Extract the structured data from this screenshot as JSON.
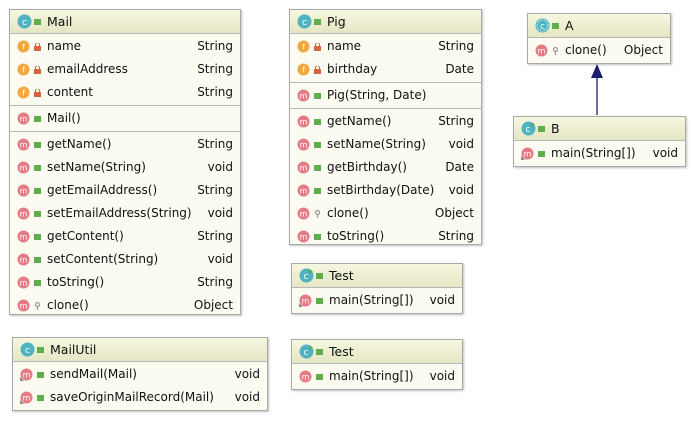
{
  "icon_colors": {
    "class": "#4fb3c2",
    "field": "#f3a83f",
    "method": "#e57b84",
    "lock": "#d3653f",
    "public": "#5fae4b",
    "arrow": "#1a1f6e"
  },
  "classes": {
    "mail": {
      "name": "Mail",
      "fields": [
        {
          "label": "name",
          "type": "String"
        },
        {
          "label": "emailAddress",
          "type": "String"
        },
        {
          "label": "content",
          "type": "String"
        }
      ],
      "constructors": [
        {
          "label": "Mail()",
          "type": ""
        }
      ],
      "methods": [
        {
          "label": "getName()",
          "type": "String"
        },
        {
          "label": "setName(String)",
          "type": "void"
        },
        {
          "label": "getEmailAddress()",
          "type": "String"
        },
        {
          "label": "setEmailAddress(String)",
          "type": "void"
        },
        {
          "label": "getContent()",
          "type": "String"
        },
        {
          "label": "setContent(String)",
          "type": "void"
        },
        {
          "label": "toString()",
          "type": "String"
        },
        {
          "label": "clone()",
          "type": "Object"
        }
      ]
    },
    "pig": {
      "name": "Pig",
      "fields": [
        {
          "label": "name",
          "type": "String"
        },
        {
          "label": "birthday",
          "type": "Date"
        }
      ],
      "constructors": [
        {
          "label": "Pig(String, Date)",
          "type": ""
        }
      ],
      "methods": [
        {
          "label": "getName()",
          "type": "String"
        },
        {
          "label": "setName(String)",
          "type": "void"
        },
        {
          "label": "getBirthday()",
          "type": "Date"
        },
        {
          "label": "setBirthday(Date)",
          "type": "void"
        },
        {
          "label": "clone()",
          "type": "Object"
        },
        {
          "label": "toString()",
          "type": "String"
        }
      ]
    },
    "a": {
      "name": "A",
      "methods": [
        {
          "label": "clone()",
          "type": "Object"
        }
      ]
    },
    "b": {
      "name": "B",
      "methods": [
        {
          "label": "main(String[])",
          "type": "void"
        }
      ]
    },
    "test1": {
      "name": "Test",
      "methods": [
        {
          "label": "main(String[])",
          "type": "void"
        }
      ]
    },
    "test2": {
      "name": "Test",
      "methods": [
        {
          "label": "main(String[])",
          "type": "void"
        }
      ]
    },
    "mailutil": {
      "name": "MailUtil",
      "methods": [
        {
          "label": "sendMail(Mail)",
          "type": "void"
        },
        {
          "label": "saveOriginMailRecord(Mail)",
          "type": "void"
        }
      ]
    }
  }
}
